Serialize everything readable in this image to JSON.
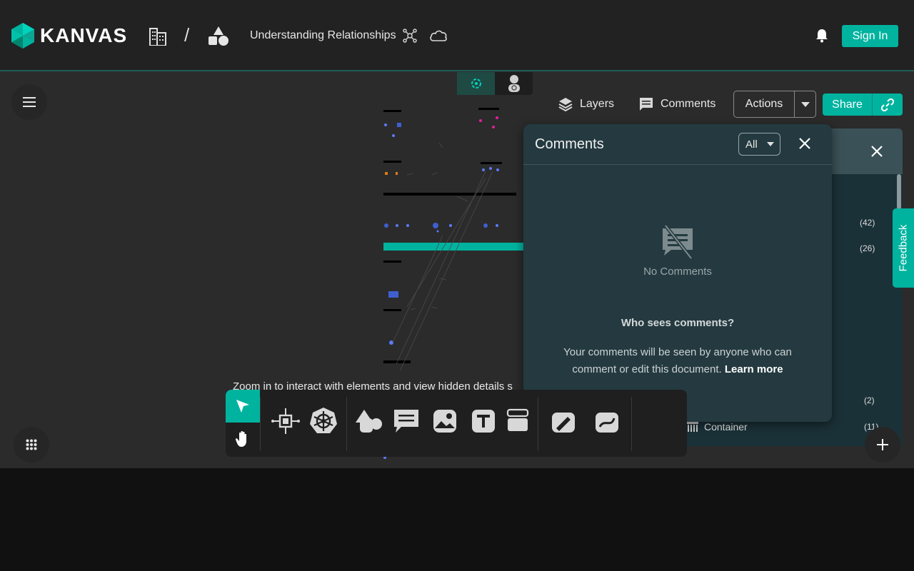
{
  "header": {
    "logo_text": "KANVAS",
    "breadcrumb_separator": "/",
    "design_title": "Understanding Relationships",
    "signin_label": "Sign In"
  },
  "toolbar": {
    "layers_label": "Layers",
    "comments_label": "Comments",
    "actions_label": "Actions",
    "share_label": "Share"
  },
  "comments_panel": {
    "title": "Comments",
    "filter_value": "All",
    "empty_text": "No Comments",
    "who_title": "Who sees comments?",
    "description": "Your comments will be seen by anyone who can comment or edit this document.",
    "learn_more": "Learn more"
  },
  "layers_panel": {
    "counts": [
      "(42)",
      "(26)",
      "(2)",
      "(11)"
    ],
    "visible_row_label": "Container"
  },
  "feedback_label": "Feedback",
  "canvas_hint": "Zoom in to interact with elements and view hidden details s",
  "colors": {
    "accent": "#00b39f",
    "header_bg": "#222222",
    "canvas_bg": "#2b2b2b",
    "panel_bg": "#243a40"
  },
  "icons": {
    "logo": "kanvas-hex-icon",
    "org": "building-icon",
    "shapes": "shapes-icon",
    "notification": "bell-icon"
  }
}
